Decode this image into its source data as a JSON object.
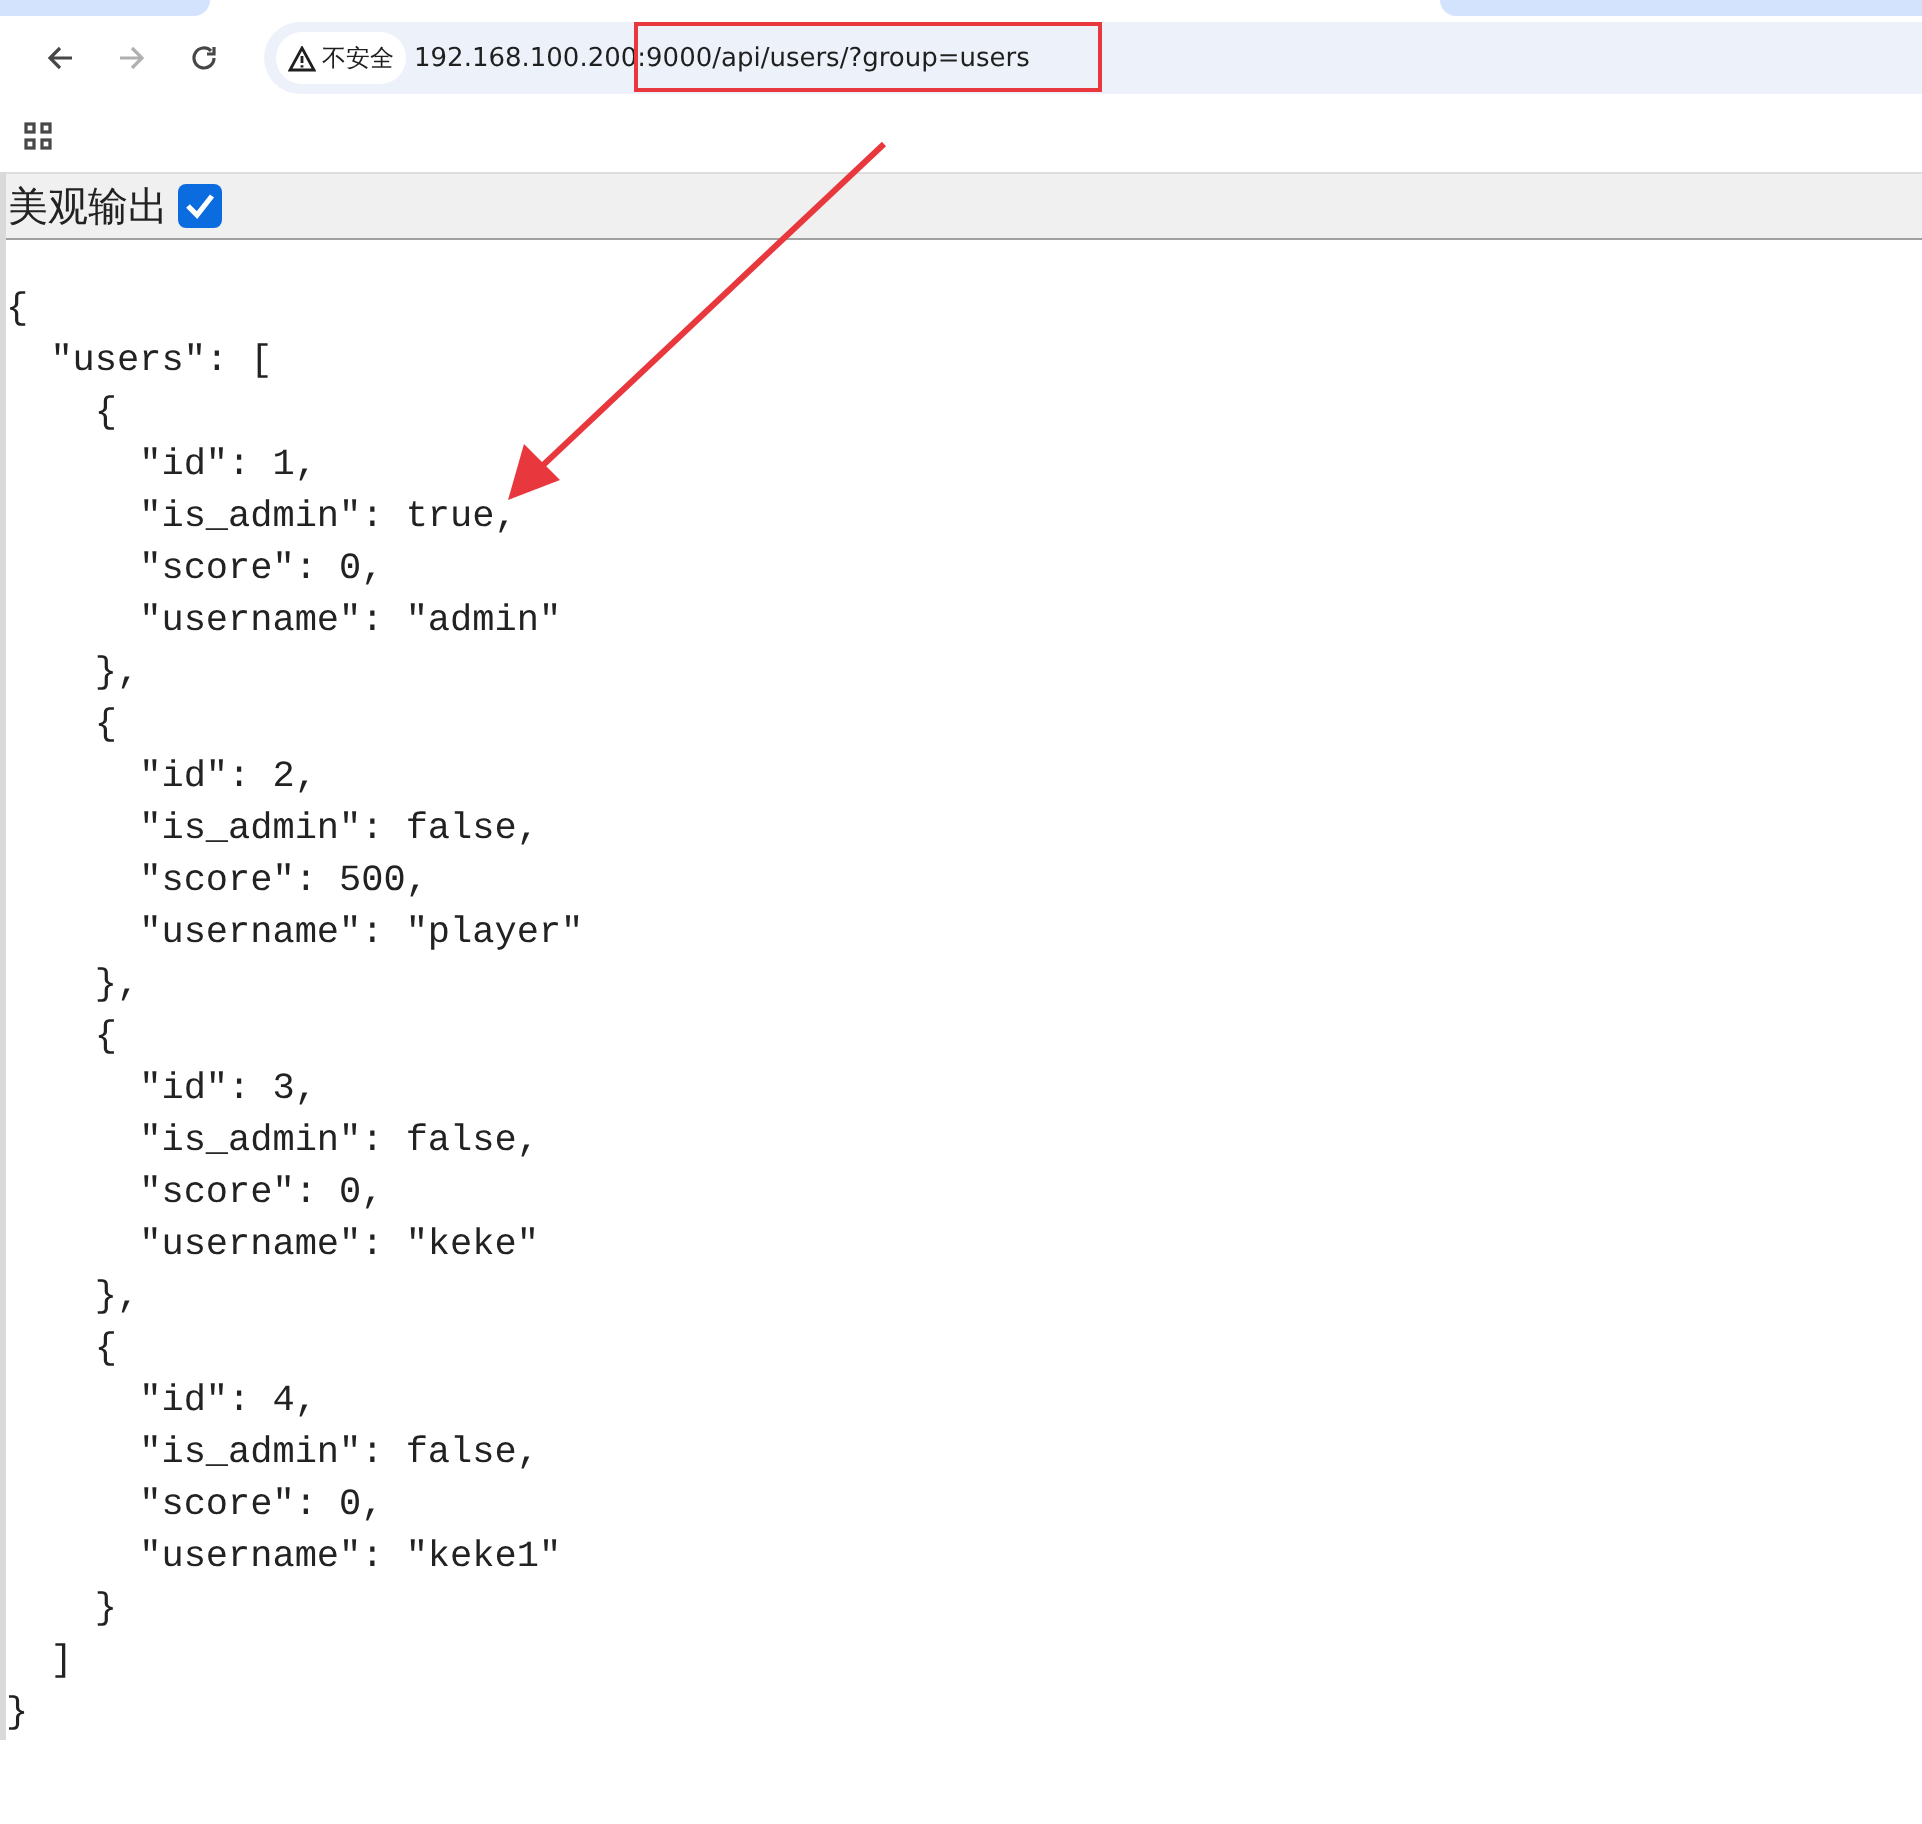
{
  "toolbar": {
    "back_disabled": false,
    "forward_disabled": true,
    "security_label": "不安全",
    "url": "192.168.100.200:9000/api/users/?group=users"
  },
  "page": {
    "pretty_print": {
      "label": "美观输出",
      "checked": true
    },
    "lines": [
      {
        "text": "{"
      },
      {
        "text": "  \"users\": ["
      },
      {
        "text": "    {"
      },
      {
        "text": "      \"id\": 1,"
      },
      {
        "text": "      \"is_admin\": true,"
      },
      {
        "text": "      \"score\": 0,"
      },
      {
        "text": "      \"username\": \"admin\""
      },
      {
        "text": "    },"
      },
      {
        "text": "    {"
      },
      {
        "text": "      \"id\": 2,"
      },
      {
        "text": "      \"is_admin\": false,"
      },
      {
        "text": "      \"score\": 500,"
      },
      {
        "text": "      \"username\": \"player\""
      },
      {
        "text": "    },"
      },
      {
        "text": "    {"
      },
      {
        "text": "      \"id\": 3,"
      },
      {
        "text": "      \"is_admin\": false,"
      },
      {
        "text": "      \"score\": 0,"
      },
      {
        "text": "      \"username\": \"keke\""
      },
      {
        "text": "    },"
      },
      {
        "text": "    {"
      },
      {
        "text": "      \"id\": 4,"
      },
      {
        "text": "      \"is_admin\": false,"
      },
      {
        "text": "      \"score\": 0,"
      },
      {
        "text": "      \"username\": \"keke1\""
      },
      {
        "text": "    }"
      },
      {
        "text": "  ]"
      },
      {
        "text": "}"
      }
    ]
  },
  "annotations": {
    "highlight_box": true,
    "arrow": true
  }
}
